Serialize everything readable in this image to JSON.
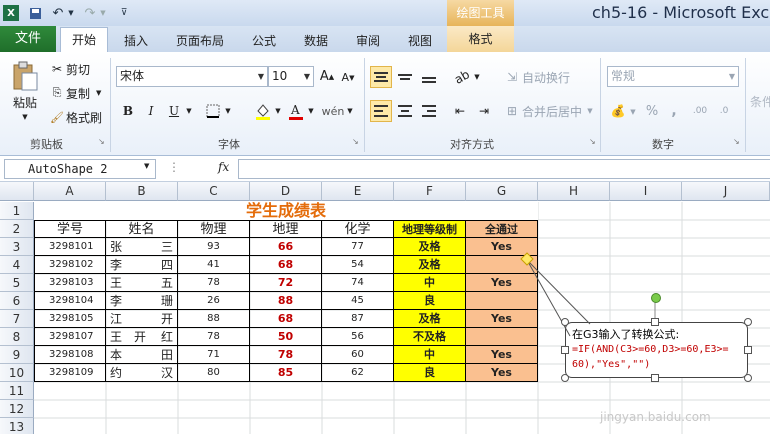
{
  "window": {
    "title": "ch5-16 - Microsoft Exce",
    "context_tool": "绘图工具"
  },
  "tabs": [
    "文件",
    "开始",
    "插入",
    "页面布局",
    "公式",
    "数据",
    "审阅",
    "视图",
    "格式"
  ],
  "ribbon": {
    "clipboard": {
      "paste": "粘贴",
      "cut": "剪切",
      "copy": "复制",
      "format_painter": "格式刷",
      "label": "剪贴板"
    },
    "font": {
      "name": "宋体",
      "size": "10",
      "label": "字体",
      "bold": "B",
      "italic": "I",
      "underline": "U"
    },
    "alignment": {
      "wrap": "自动换行",
      "merge": "合并后居中",
      "label": "对齐方式"
    },
    "number": {
      "format": "常规",
      "label": "数字",
      "percent": "%",
      "comma": ","
    },
    "styles_partial": "条件"
  },
  "formula_bar": {
    "name_box": "AutoShape 2",
    "fx": "fx",
    "content": ""
  },
  "columns": [
    "A",
    "B",
    "C",
    "D",
    "E",
    "F",
    "G",
    "H",
    "I",
    "J"
  ],
  "rows": [
    "1",
    "2",
    "3",
    "4",
    "5",
    "6",
    "7",
    "8",
    "9",
    "10",
    "11",
    "12",
    "13"
  ],
  "sheet": {
    "title": "学生成绩表",
    "headers": [
      "学号",
      "姓名",
      "物理",
      "地理",
      "化学",
      "地理等级制",
      "全通过"
    ],
    "records": [
      {
        "id": "3298101",
        "n1": "张",
        "n2": "三",
        "phys": "93",
        "geo": "66",
        "chem": "77",
        "grade": "及格",
        "pass": "Yes"
      },
      {
        "id": "3298102",
        "n1": "李",
        "n2": "四",
        "phys": "41",
        "geo": "68",
        "chem": "54",
        "grade": "及格",
        "pass": ""
      },
      {
        "id": "3298103",
        "n1": "王",
        "n2": "五",
        "phys": "78",
        "geo": "72",
        "chem": "74",
        "grade": "中",
        "pass": "Yes"
      },
      {
        "id": "3298104",
        "n1": "李",
        "n2": "珊",
        "phys": "26",
        "geo": "88",
        "chem": "45",
        "grade": "良",
        "pass": ""
      },
      {
        "id": "3298105",
        "n1": "江",
        "n2": "开",
        "phys": "88",
        "geo": "68",
        "chem": "87",
        "grade": "及格",
        "pass": "Yes"
      },
      {
        "id": "3298107",
        "n1": "王　开",
        "n2": "红",
        "phys": "78",
        "geo": "50",
        "chem": "56",
        "grade": "不及格",
        "pass": ""
      },
      {
        "id": "3298108",
        "n1": "本",
        "n2": "田",
        "phys": "71",
        "geo": "78",
        "chem": "60",
        "grade": "中",
        "pass": "Yes"
      },
      {
        "id": "3298109",
        "n1": "约",
        "n2": "汉",
        "phys": "80",
        "geo": "85",
        "chem": "62",
        "grade": "良",
        "pass": "Yes"
      }
    ]
  },
  "callout": {
    "line1": "在G3输入了转换公式:",
    "line2": "=IF(AND(C3>=60,D3>=60,E3>=",
    "line3": "60),\"Yes\",\"\")"
  },
  "watermark": "jingyan.baidu.com",
  "colors": {
    "file_tab": "#1f6e2a",
    "yellow": "#ffff00",
    "orange": "#fac090",
    "red_text": "#c00000",
    "title_orange": "#e46c0a"
  }
}
